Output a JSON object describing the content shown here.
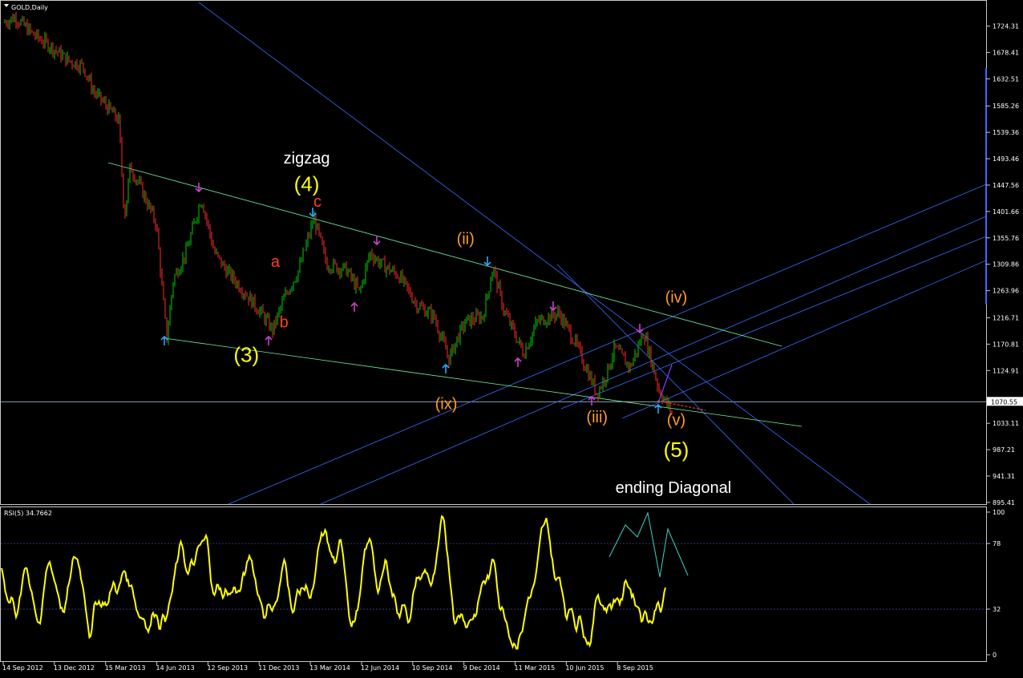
{
  "window": {
    "symbol_label": "GOLD,Daily",
    "indicator_label": "RSI(5) 34.7662"
  },
  "colors": {
    "background": "#000000",
    "panel_border": "#c8c8c8",
    "price_bars_up": "#00d000",
    "price_bars_down": "#ff2a2a",
    "channel_lines": "#3a6cff",
    "diagonal_lines": "#70f0a0",
    "rsi_line": "#ffff00",
    "wave_yellow": "#ffff00",
    "wave_orange": "#ff9a2a",
    "wave_red": "#ff4020",
    "wave_white": "#ffffff",
    "arrow_blue": "#2aa8ff",
    "arrow_magenta": "#d040d0"
  },
  "chart_data": [
    {
      "type": "line",
      "symbol": "GOLD",
      "timeframe": "Daily",
      "ylim": [
        875,
        1760
      ],
      "y_ticks": [
        "1724.31",
        "1678.41",
        "1632.51",
        "1585.26",
        "1539.36",
        "1493.46",
        "1447.56",
        "1401.66",
        "1355.76",
        "1309.86",
        "1263.96",
        "1216.71",
        "1170.81",
        "1124.91",
        "1033.11",
        "987.21",
        "941.31",
        "895.41"
      ],
      "current_price": "1070.55",
      "x_tick_labels": [
        "14 Sep 2012",
        "13 Dec 2012",
        "15 Mar 2013",
        "14 Jun 2013",
        "12 Sep 2013",
        "11 Dec 2013",
        "13 Mar 2014",
        "12 Jun 2014",
        "10 Sep 2014",
        "9 Dec 2014",
        "11 Mar 2015",
        "10 Jun 2015",
        "8 Sep 2015"
      ],
      "price_path": {
        "x": [
          "2012-09-14",
          "2012-10-05",
          "2012-11-05",
          "2012-12-05",
          "2013-01-05",
          "2013-02-01",
          "2013-02-20",
          "2013-03-10",
          "2013-04-05",
          "2013-04-15",
          "2013-04-25",
          "2013-05-15",
          "2013-06-10",
          "2013-06-28",
          "2013-07-10",
          "2013-08-01",
          "2013-08-28",
          "2013-09-20",
          "2013-10-10",
          "2013-11-05",
          "2013-12-15",
          "2013-12-31",
          "2014-01-20",
          "2014-02-15",
          "2014-03-14",
          "2014-04-05",
          "2014-05-10",
          "2014-06-02",
          "2014-06-20",
          "2014-07-10",
          "2014-08-10",
          "2014-09-10",
          "2014-10-10",
          "2014-11-06",
          "2014-11-20",
          "2014-12-05",
          "2015-01-05",
          "2015-01-22",
          "2015-02-10",
          "2015-03-17",
          "2015-04-10",
          "2015-05-18",
          "2015-06-15",
          "2015-07-24",
          "2015-08-10",
          "2015-08-24",
          "2015-09-20",
          "2015-10-14",
          "2015-11-10",
          "2015-12-03"
        ],
        "close": [
          1730,
          1740,
          1710,
          1690,
          1665,
          1655,
          1610,
          1590,
          1560,
          1390,
          1480,
          1440,
          1380,
          1180,
          1285,
          1330,
          1425,
          1330,
          1300,
          1270,
          1220,
          1195,
          1250,
          1300,
          1390,
          1310,
          1300,
          1260,
          1330,
          1310,
          1290,
          1240,
          1220,
          1145,
          1180,
          1210,
          1220,
          1305,
          1230,
          1155,
          1210,
          1225,
          1175,
          1085,
          1120,
          1165,
          1130,
          1192,
          1090,
          1050
        ]
      },
      "wave_labels": [
        {
          "text": "zigzag",
          "color": "white",
          "x": "2014-03-01",
          "y": 1485
        },
        {
          "text": "(4)",
          "color": "yellow",
          "x": "2014-03-01",
          "y": 1437
        },
        {
          "text": "c",
          "color": "red",
          "x": "2014-03-20",
          "y": 1410
        },
        {
          "text": "a",
          "color": "red",
          "x": "2014-01-05",
          "y": 1305
        },
        {
          "text": "b",
          "color": "red",
          "x": "2014-01-20",
          "y": 1200
        },
        {
          "text": "(3)",
          "color": "yellow",
          "x": "2013-11-15",
          "y": 1140
        },
        {
          "text": "(ii)",
          "color": "orange",
          "x": "2014-12-05",
          "y": 1345
        },
        {
          "text": "(ix)",
          "color": "orange",
          "x": "2014-11-01",
          "y": 1058
        },
        {
          "text": "(iii)",
          "color": "orange",
          "x": "2015-07-24",
          "y": 1035
        },
        {
          "text": "(iv)",
          "color": "orange",
          "x": "2015-12-10",
          "y": 1243
        },
        {
          "text": "(v)",
          "color": "orange",
          "x": "2015-12-10",
          "y": 1030
        },
        {
          "text": "(5)",
          "color": "yellow",
          "x": "2015-12-10",
          "y": 975
        },
        {
          "text": "ending Diagonal",
          "color": "white",
          "x": "2015-12-05",
          "y": 912
        }
      ]
    },
    {
      "type": "line",
      "name": "RSI(5)",
      "current_value": 34.7662,
      "ylim": [
        0,
        100
      ],
      "y_ticks": [
        100,
        78,
        32,
        0
      ],
      "levels": [
        78,
        32
      ]
    }
  ]
}
